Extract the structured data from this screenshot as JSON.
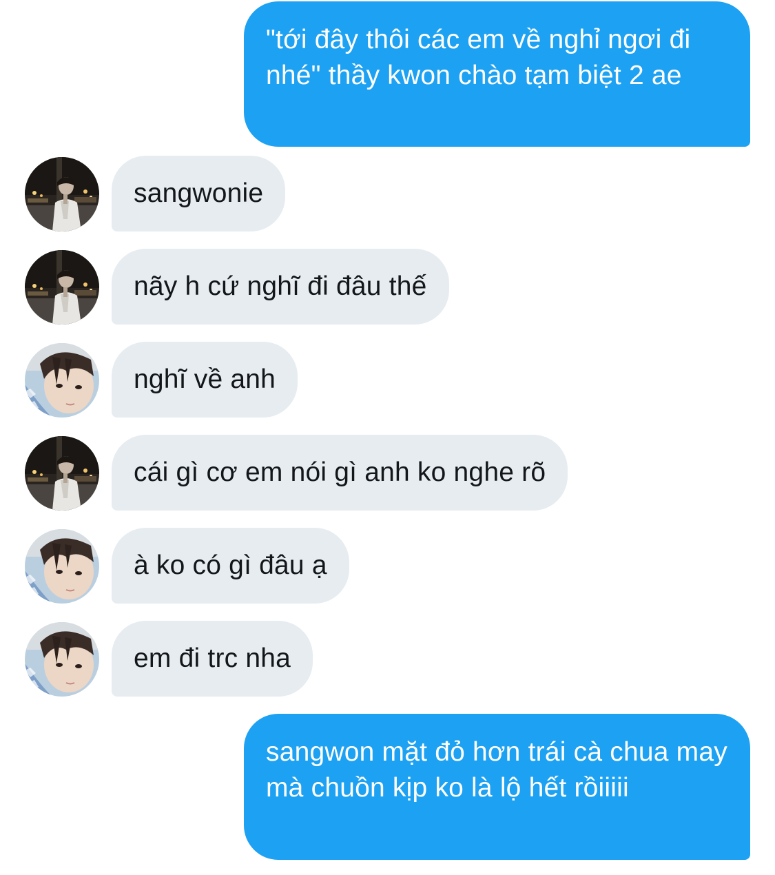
{
  "conversation": {
    "messages": [
      {
        "direction": "outgoing",
        "text": "\"tới đây thôi các em về nghỉ ngơi đi nhé\" thầy kwon chào tạm biệt 2 ae"
      },
      {
        "direction": "incoming",
        "avatar": "avatar-night-street",
        "text": "sangwonie"
      },
      {
        "direction": "incoming",
        "avatar": "avatar-night-street",
        "text": "nãy h cứ nghĩ đi đâu thế"
      },
      {
        "direction": "incoming",
        "avatar": "avatar-selfie",
        "text": "nghĩ về anh"
      },
      {
        "direction": "incoming",
        "avatar": "avatar-night-street",
        "text": "cái gì cơ em nói gì anh ko nghe rõ"
      },
      {
        "direction": "incoming",
        "avatar": "avatar-selfie",
        "text": "à ko có gì đâu ạ"
      },
      {
        "direction": "incoming",
        "avatar": "avatar-selfie",
        "text": "em đi trc nha"
      },
      {
        "direction": "outgoing",
        "text": "sangwon mặt đỏ hơn trái cà chua may mà chuồn kịp ko là lộ hết rồiiiii"
      }
    ]
  },
  "colors": {
    "outgoing_bubble": "#1da1f2",
    "incoming_bubble": "#e6ecf0",
    "incoming_text": "#14171a",
    "outgoing_text": "#ffffff",
    "background": "#ffffff"
  }
}
